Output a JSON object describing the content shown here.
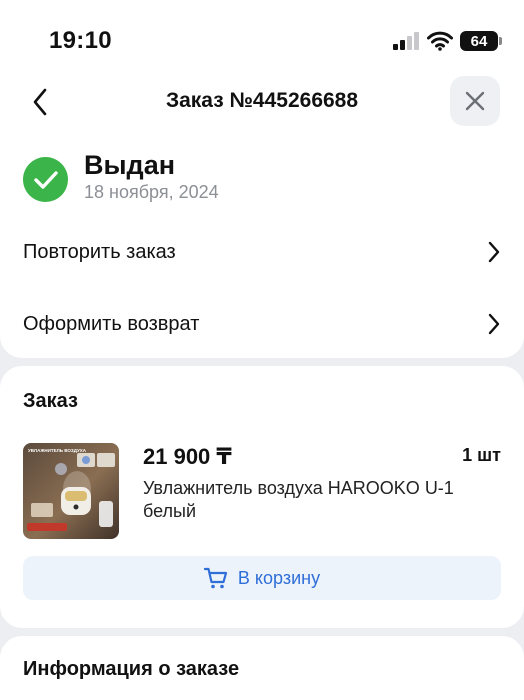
{
  "status_bar": {
    "time": "19:10",
    "battery": "64"
  },
  "header": {
    "title": "Заказ №445266688"
  },
  "order_status": {
    "title": "Выдан",
    "date": "18 ноября, 2024",
    "status_color": "#3bb54a"
  },
  "actions": {
    "repeat_label": "Повторить заказ",
    "return_label": "Оформить возврат"
  },
  "order": {
    "section_title": "Заказ",
    "product": {
      "price": "21 900 ₸",
      "quantity": "1 шт",
      "name": "Увлажнитель воздуха HAROOKO U-1 белый",
      "image_text": "УВЛАЖНИТЕЛЬ ВОЗДУХА"
    },
    "cart_button_label": "В корзину",
    "accent_color": "#2f6fd8"
  },
  "info": {
    "section_title": "Информация о заказе"
  }
}
